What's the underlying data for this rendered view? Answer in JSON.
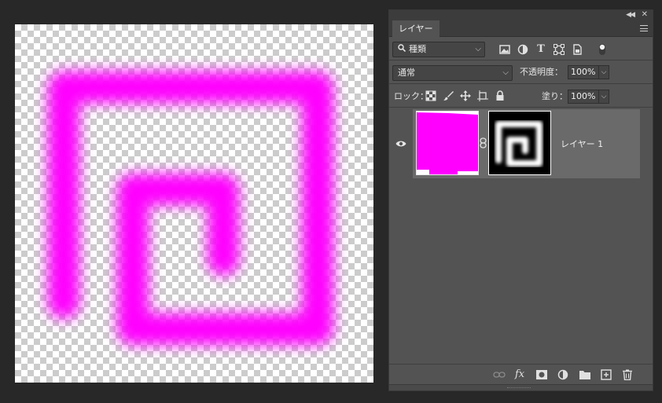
{
  "canvas": {
    "stroke_color": "#ff00ff",
    "checker_light": "#ffffff",
    "checker_dark": "#cccccc"
  },
  "panel": {
    "tab_label": "レイヤー",
    "filter": {
      "selected": "種類",
      "icons": [
        "image-filter-icon",
        "adjustment-filter-icon",
        "type-filter-icon",
        "shape-filter-icon",
        "smart-object-filter-icon",
        "filter-toggle-icon"
      ]
    },
    "blend": {
      "mode": "通常",
      "opacity_label": "不透明度：",
      "opacity_value": "100%"
    },
    "lock": {
      "label": "ロック：",
      "icons": [
        "lock-transparent-pixels-icon",
        "lock-image-pixels-icon",
        "lock-position-icon",
        "lock-artboard-icon",
        "lock-all-icon"
      ],
      "fill_label": "塗り：",
      "fill_value": "100%"
    },
    "layers": [
      {
        "name": "レイヤー 1",
        "visible": true,
        "thumb_color": "#ff00ff",
        "has_mask": true,
        "selected": true
      }
    ],
    "bottom_icons": [
      "link-layers-icon",
      "fx-icon",
      "add-mask-icon",
      "adjustment-layer-icon",
      "new-group-icon",
      "new-layer-icon",
      "delete-layer-icon"
    ],
    "fx_label": "fx"
  }
}
